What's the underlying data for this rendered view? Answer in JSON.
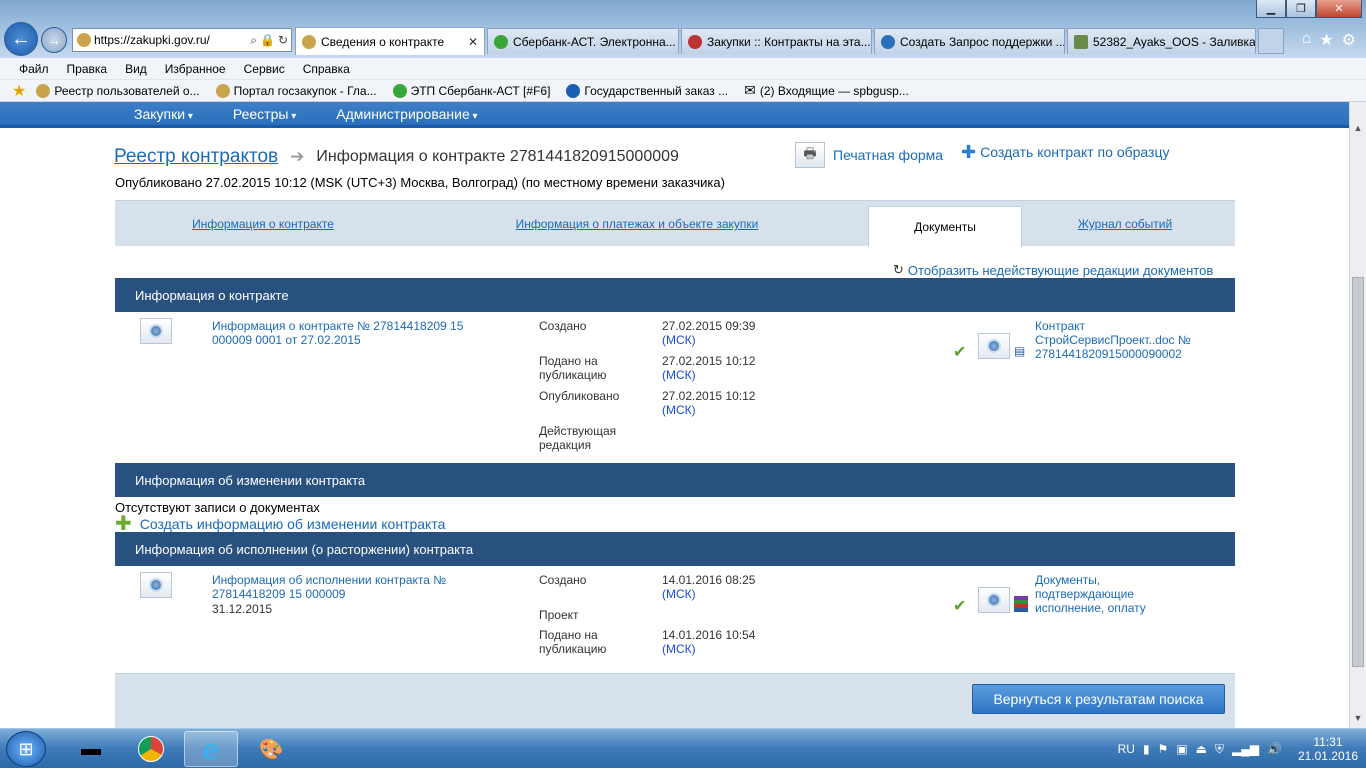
{
  "browser": {
    "address": "https://zakupki.gov.ru/",
    "tabs": [
      {
        "title": "Сведения о контракте"
      },
      {
        "title": "Сбербанк-АСТ. Электронна..."
      },
      {
        "title": "Закупки :: Контракты на эта..."
      },
      {
        "title": "Создать Запрос поддержки ..."
      },
      {
        "title": "52382_Ayaks_OOS - Заливка ..."
      }
    ],
    "menu": [
      "Файл",
      "Правка",
      "Вид",
      "Избранное",
      "Сервис",
      "Справка"
    ],
    "favorites": [
      "Реестр пользователей о...",
      "Портал госзакупок - Гла...",
      "ЭТП Сбербанк-АСТ [#F6]",
      "Государственный заказ ...",
      "(2) Входящие — spbgusp..."
    ]
  },
  "topnav": [
    "Закупки",
    "Реестры",
    "Администрирование"
  ],
  "header": {
    "crumb_main": "Реестр контрактов",
    "crumb_info": "Информация о контракте 2781441820915000009",
    "published": "Опубликовано 27.02.2015 10:12 (MSK (UTC+3) Москва, Волгоград) (по местному времени заказчика)",
    "print_label": "Печатная форма",
    "create_label": "Создать контракт по образцу"
  },
  "page_tabs": [
    {
      "label": "Информация о контракте"
    },
    {
      "label": "Информация о платежах и объекте закупки"
    },
    {
      "label": "Документы"
    },
    {
      "label": "Журнал событий"
    }
  ],
  "show_old": "Отобразить недействующие редакции документов",
  "sections": {
    "contract_info": {
      "title": "Информация о контракте",
      "doc_link_1": "Информация о контракте № 27814418209 15",
      "doc_link_2": "000009 0001 от 27.02.2015",
      "created_label": "Создано",
      "created_value": "27.02.2015 09:39",
      "submitted_label_1": "Подано на",
      "submitted_label_2": "публикацию",
      "submitted_value": "27.02.2015 10:12",
      "published_label": "Опубликовано",
      "published_value": "27.02.2015 10:12",
      "status_label_1": "Действующая",
      "status_label_2": "редакция",
      "msk": "(МСК)",
      "file_1": "Контракт",
      "file_2": "СтройСервисПроект..doc №",
      "file_3": "2781441820915000090002"
    },
    "change_info": {
      "title": "Информация об изменении контракта",
      "no_records": "Отсутствуют записи о документах",
      "create_link": "Создать информацию об изменении контракта"
    },
    "execution_info": {
      "title": "Информация об исполнении (о расторжении) контракта",
      "doc_link_1": "Информация об исполнении контракта №",
      "doc_link_2": "27814418209 15 000009",
      "doc_date": "31.12.2015",
      "created_label": "Создано",
      "created_value": "14.01.2016 08:25",
      "project_label": "Проект",
      "submitted_label_1": "Подано на",
      "submitted_label_2": "публикацию",
      "submitted_value": "14.01.2016 10:54",
      "msk": "(МСК)",
      "file_1": "Документы,",
      "file_2": "подтверждающие",
      "file_3": "исполнение, оплату"
    }
  },
  "back_button": "Вернуться к результатам поиска",
  "taskbar": {
    "lang": "RU",
    "time": "11:31",
    "date": "21.01.2016"
  }
}
